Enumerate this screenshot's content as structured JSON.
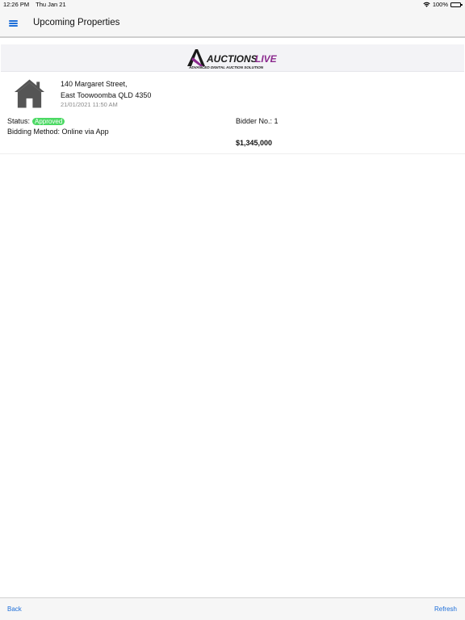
{
  "status_bar": {
    "time": "12:26 PM",
    "date": "Thu Jan 21",
    "battery": "100%",
    "icons": [
      "wifi-icon",
      "battery-icon"
    ]
  },
  "nav": {
    "title": "Upcoming Properties",
    "menu_icon": "hamburger-menu-icon"
  },
  "logo": {
    "name": "AUCTIONS",
    "name_accent": "LIVE",
    "tagline": "ADVANCED DIGITAL AUCTION SOLUTION",
    "colors": {
      "dark": "#1a1a1a",
      "accent": "#8b2a8e"
    }
  },
  "property": {
    "icon": "house-icon",
    "address_line1": "140 Margaret Street,",
    "address_line2": "East Toowoomba QLD 4350",
    "datetime": "21/01/2021 11:50 AM",
    "status_label": "Status:",
    "status_value": "Approved",
    "bidding_method": "Bidding Method: Online via App",
    "bidder_no": "Bidder No.: 1",
    "price": "$1,345,000"
  },
  "toolbar": {
    "back_label": "Back",
    "refresh_label": "Refresh"
  },
  "colors": {
    "accent_blue": "#1e6fd9",
    "approved_green": "#4cd964",
    "bar_bg": "#f6f6f6"
  }
}
